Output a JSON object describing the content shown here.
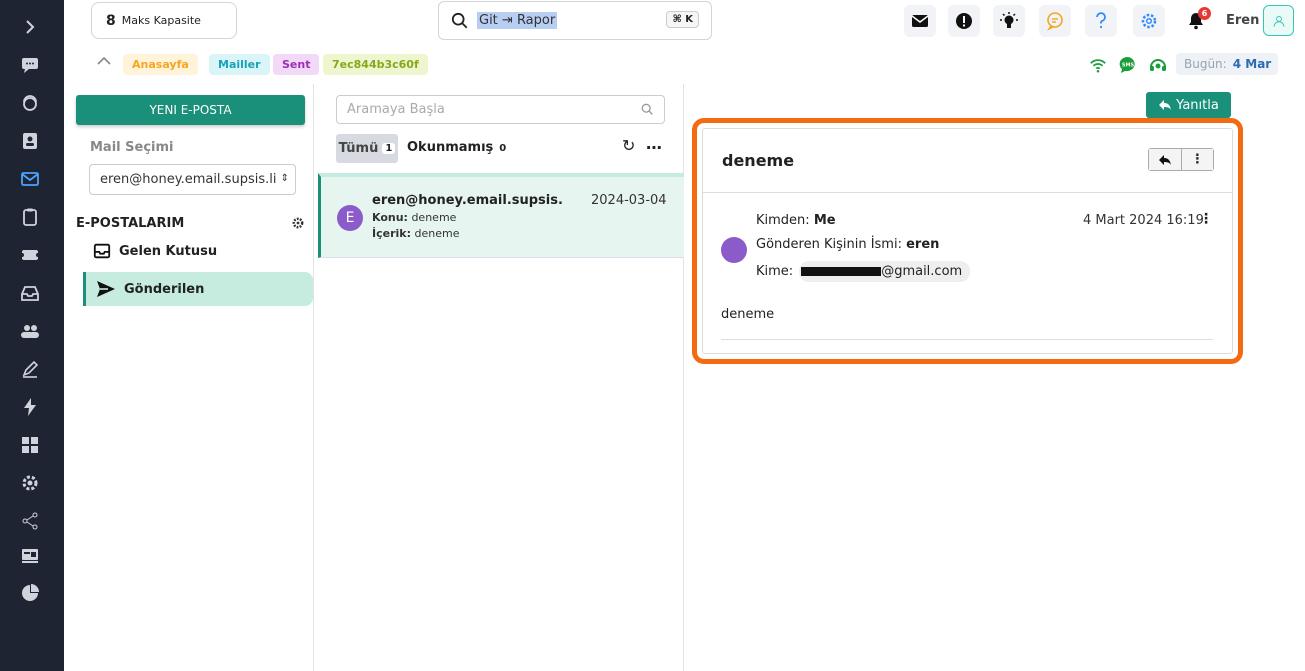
{
  "sidebar": {
    "icons": [
      "chevron-right-icon",
      "chat-icon",
      "support-icon",
      "contact-card-icon",
      "mail-icon",
      "clipboard-icon",
      "ticket-icon",
      "inbox-tray-icon",
      "users-icon",
      "pen-icon",
      "lightning-icon",
      "grid-icon",
      "settings-icon",
      "share-icon",
      "dashboard-icon",
      "pie-chart-icon"
    ],
    "active": "mail-icon"
  },
  "topbar": {
    "capacity_number": "8",
    "capacity_label": "Maks Kapasite",
    "search_text": "Git ⇥ Rapor",
    "search_shortcut": "⌘ K",
    "notification_count": "6",
    "user_name": "Eren"
  },
  "breadcrumb": {
    "items": [
      {
        "label": "Anasayfa",
        "color": "#f5a623",
        "bg": "#fff3d9"
      },
      {
        "label": "Mailler",
        "color": "#1aa3b8",
        "bg": "#d9f5f8"
      },
      {
        "label": "Sent",
        "color": "#9b2fb5",
        "bg": "#f1d9f7"
      },
      {
        "label": "7ec844b3c60f",
        "color": "#8aa61b",
        "bg": "#eef6cf"
      }
    ]
  },
  "status": {
    "today_label": "Bugün:",
    "today_value": "4 Mar"
  },
  "left": {
    "new_mail_label": "YENI E-POSTA",
    "mail_select_label": "Mail Seçimi",
    "mail_select_value": "eren@honey.email.supsis.li",
    "my_mails_label": "E-POSTALARIM",
    "folders": [
      {
        "label": "Gelen Kutusu"
      },
      {
        "label": "Gönderilen"
      }
    ]
  },
  "middle": {
    "search_placeholder": "Aramaya Başla",
    "filter_all_label": "Tümü",
    "filter_all_count": "1",
    "filter_unread_label": "Okunmamış",
    "filter_unread_count": "0",
    "mail": {
      "avatar_letter": "E",
      "from": "eren@honey.email.supsis....",
      "date": "2024-03-04",
      "subject_label": "Konu:",
      "subject": "deneme",
      "content_label": "İçerik:",
      "content": "deneme"
    }
  },
  "detail": {
    "reply_label": "Yanıtla",
    "title": "deneme",
    "from_label": "Kimden:",
    "from_value": "Me",
    "date": "4 Mart 2024 16:19",
    "sender_name_label": "Gönderen Kişinin İsmi:",
    "sender_name_value": "eren",
    "to_label": "Kime:",
    "to_domain": "@gmail.com",
    "body": "deneme",
    "highlight_color": "#f26a12"
  }
}
